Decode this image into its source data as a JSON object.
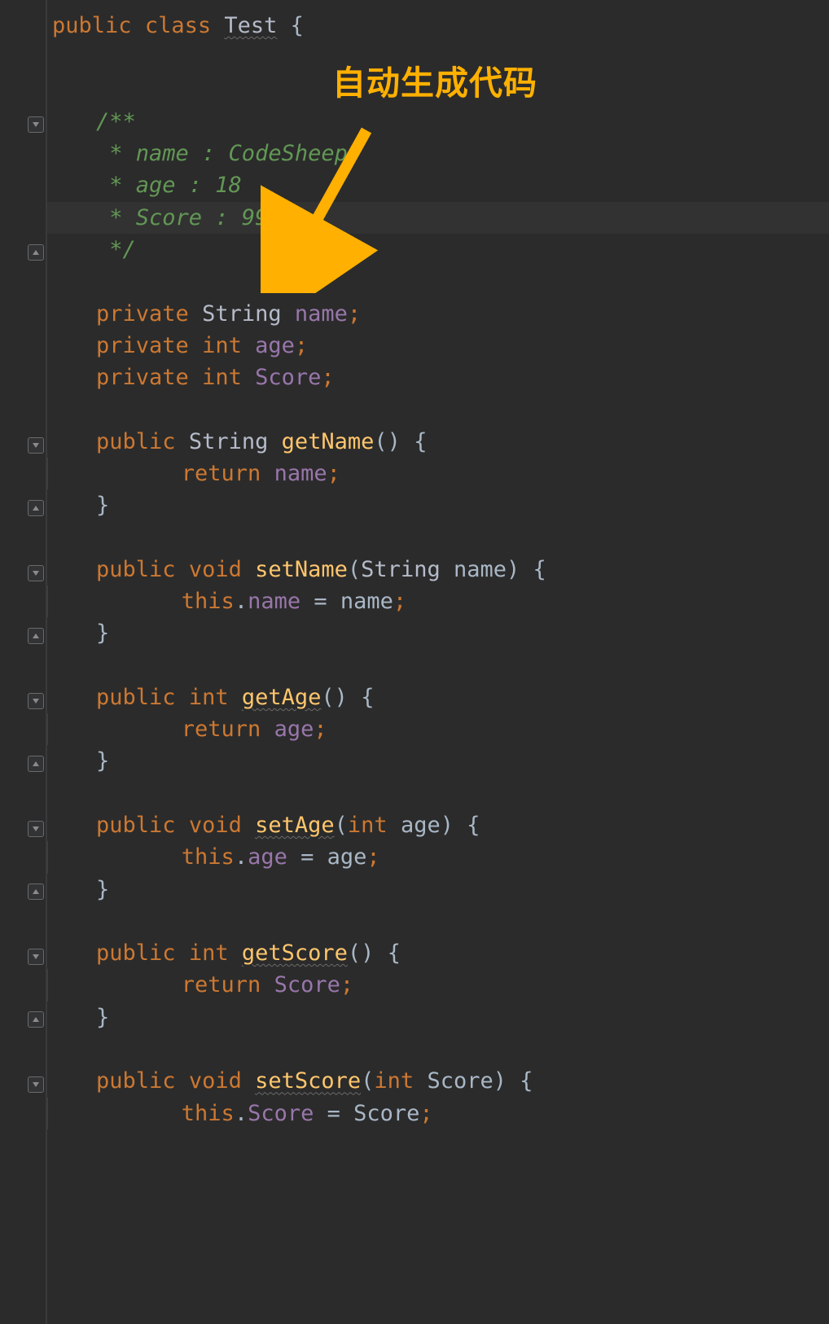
{
  "annotation": {
    "label": "自动生成代码"
  },
  "code": {
    "class_decl": {
      "modifier": "public",
      "keyword": "class",
      "name": "Test",
      "brace": "{"
    },
    "doc": {
      "open": "/**",
      "l1": " * name : CodeSheep",
      "l2": " * age : 18",
      "l3": " * Score : 99",
      "close": " */"
    },
    "fields": {
      "f1": {
        "mod": "private",
        "type": "String",
        "name": "name",
        "sc": ";"
      },
      "f2": {
        "mod": "private",
        "type": "int",
        "name": "age",
        "sc": ";"
      },
      "f3": {
        "mod": "private",
        "type": "int",
        "name": "Score",
        "sc": ";"
      }
    },
    "m_getName": {
      "mod": "public",
      "ret": "String",
      "name": "getName",
      "params": "()",
      "open": "{",
      "ret_kw": "return",
      "ret_val": "name",
      "sc": ";",
      "close": "}"
    },
    "m_setName": {
      "mod": "public",
      "ret": "void",
      "name": "setName",
      "pOpen": "(",
      "pType": "String",
      "pName": "name",
      "pClose": ")",
      "open": "{",
      "thisKw": "this",
      "dot": ".",
      "lhs": "name",
      "eq": " = ",
      "rhs": "name",
      "sc": ";",
      "close": "}"
    },
    "m_getAge": {
      "mod": "public",
      "ret": "int",
      "name": "getAge",
      "params": "()",
      "open": "{",
      "ret_kw": "return",
      "ret_val": "age",
      "sc": ";",
      "close": "}"
    },
    "m_setAge": {
      "mod": "public",
      "ret": "void",
      "name": "setAge",
      "pOpen": "(",
      "pType": "int",
      "pName": "age",
      "pClose": ")",
      "open": "{",
      "thisKw": "this",
      "dot": ".",
      "lhs": "age",
      "eq": " = ",
      "rhs": "age",
      "sc": ";",
      "close": "}"
    },
    "m_getScore": {
      "mod": "public",
      "ret": "int",
      "name": "getScore",
      "params": "()",
      "open": "{",
      "ret_kw": "return",
      "ret_val": "Score",
      "sc": ";",
      "close": "}"
    },
    "m_setScore": {
      "mod": "public",
      "ret": "void",
      "name": "setScore",
      "pOpen": "(",
      "pType": "int",
      "pName": "Score",
      "pClose": ")",
      "open": "{",
      "thisKw": "this",
      "dot": ".",
      "lhs": "Score",
      "eq": " = ",
      "rhs": "Score",
      "sc": ";"
    }
  }
}
